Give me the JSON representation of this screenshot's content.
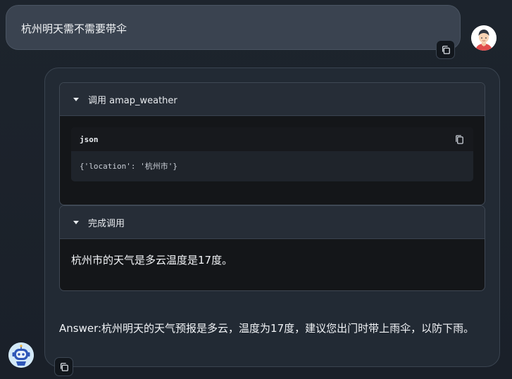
{
  "user_message": {
    "text": "杭州明天需不需要带伞"
  },
  "assistant_message": {
    "tool_call": {
      "title": "调用 amap_weather",
      "code_lang": "json",
      "code": "{'location': '杭州市'}"
    },
    "tool_result": {
      "title": "完成调用",
      "text": "杭州市的天气是多云温度是17度。"
    },
    "answer": "Answer:杭州明天的天气预报是多云，温度为17度，建议您出门时带上雨伞，以防下雨。"
  },
  "icons": {
    "copy": "copy-icon",
    "user_avatar": "user-avatar-icon",
    "bot_avatar": "robot-avatar-icon",
    "caret": "caret-down-icon"
  },
  "colors": {
    "background": "#1b222b",
    "user_bubble": "#3a4350",
    "bot_bubble": "#222a34",
    "panel": "#141619",
    "text": "#f2f4f7"
  }
}
